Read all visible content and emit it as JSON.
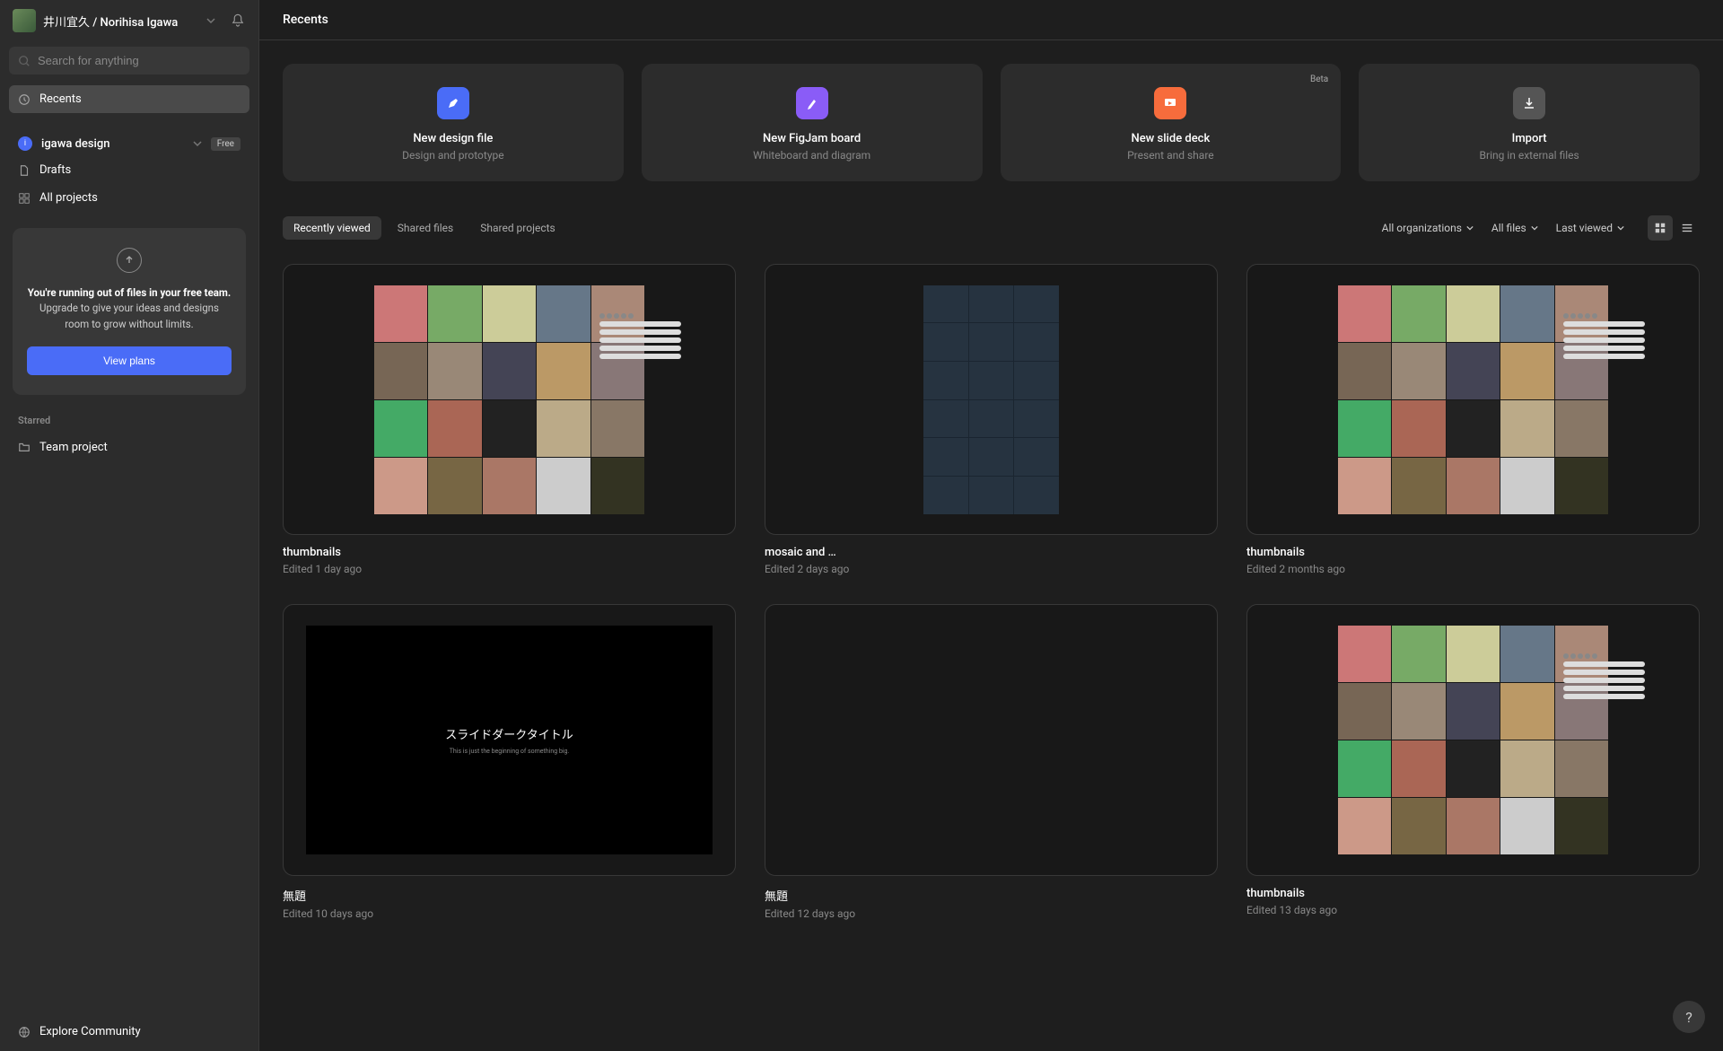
{
  "header": {
    "user_name": "井川宜久 / Norihisa Igawa",
    "page_title": "Recents"
  },
  "search": {
    "placeholder": "Search for anything"
  },
  "nav": {
    "recents": "Recents",
    "drafts": "Drafts",
    "all_projects": "All projects"
  },
  "team": {
    "name": "igawa design",
    "initial": "i",
    "badge": "Free"
  },
  "upgrade": {
    "bold": "You're running out of files in your free team.",
    "rest": " Upgrade to give your ideas and designs room to grow without limits.",
    "button": "View plans"
  },
  "starred": {
    "label": "Starred",
    "item": "Team project"
  },
  "explore": "Explore Community",
  "create": [
    {
      "title": "New design file",
      "sub": "Design and prototype",
      "beta": ""
    },
    {
      "title": "New FigJam board",
      "sub": "Whiteboard and diagram",
      "beta": ""
    },
    {
      "title": "New slide deck",
      "sub": "Present and share",
      "beta": "Beta"
    },
    {
      "title": "Import",
      "sub": "Bring in external files",
      "beta": ""
    }
  ],
  "tabs": [
    "Recently viewed",
    "Shared files",
    "Shared projects"
  ],
  "filters": {
    "org": "All organizations",
    "files": "All files",
    "sort": "Last viewed"
  },
  "files": [
    {
      "title": "thumbnails",
      "meta": "Edited 1 day ago",
      "thumb": "mosaic"
    },
    {
      "title": "mosaic and …",
      "meta": "Edited 2 days ago",
      "thumb": "dark"
    },
    {
      "title": "thumbnails",
      "meta": "Edited 2 months ago",
      "thumb": "mosaic"
    },
    {
      "title": "無題",
      "meta": "Edited 10 days ago",
      "thumb": "slide"
    },
    {
      "title": "無題",
      "meta": "Edited 12 days ago",
      "thumb": "empty"
    },
    {
      "title": "thumbnails",
      "meta": "Edited 13 days ago",
      "thumb": "mosaic"
    }
  ],
  "slide_thumb": {
    "title": "スライドダークタイトル",
    "sub": "This is just the beginning of something big."
  }
}
